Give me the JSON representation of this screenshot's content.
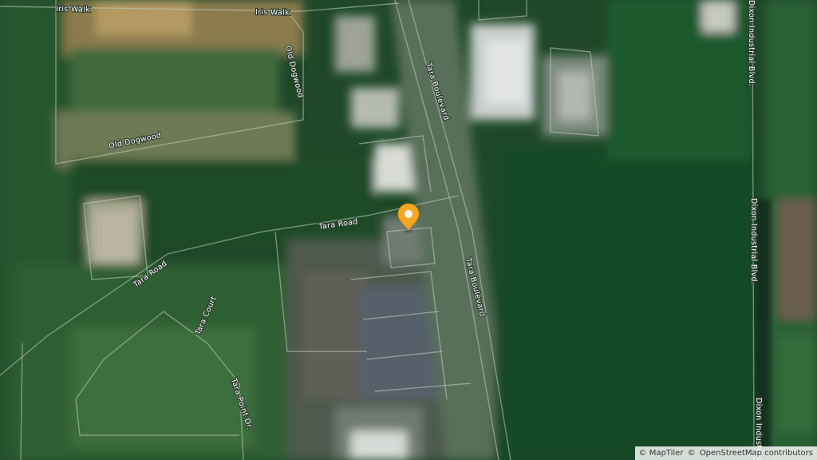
{
  "map": {
    "roads": [
      {
        "id": "iris-walk-1",
        "label": "Iris Walk"
      },
      {
        "id": "iris-walk-2",
        "label": "Iris Walk"
      },
      {
        "id": "old-dogwood-v",
        "label": "Old Dogwood"
      },
      {
        "id": "old-dogwood-h",
        "label": "Old Dogwood"
      },
      {
        "id": "tara-boulevard-n",
        "label": "Tara Boulevard"
      },
      {
        "id": "tara-boulevard-s",
        "label": "Tara Boulevard"
      },
      {
        "id": "tara-road-e",
        "label": "Tara Road"
      },
      {
        "id": "tara-road-w",
        "label": "Tara Road"
      },
      {
        "id": "tara-court",
        "label": "Tara Court"
      },
      {
        "id": "tara-point-dr",
        "label": "Tara Point Dr."
      },
      {
        "id": "dixon-industrial-1",
        "label": "Dixon Industrial Blvd."
      },
      {
        "id": "dixon-industrial-2",
        "label": "Dixon Industrial Blvd."
      },
      {
        "id": "dixon-industrial-3",
        "label": "Dixon Industrial"
      }
    ],
    "marker": {
      "color": "#f5a623",
      "name": "location-pin"
    }
  },
  "attribution": {
    "copyright": "©",
    "maptiler": "MapTiler",
    "osm": "OpenStreetMap contributors"
  },
  "colors": {
    "forest": "#1f4a2a",
    "road_line": "#b8c2b0",
    "marker": "#f5a623"
  }
}
